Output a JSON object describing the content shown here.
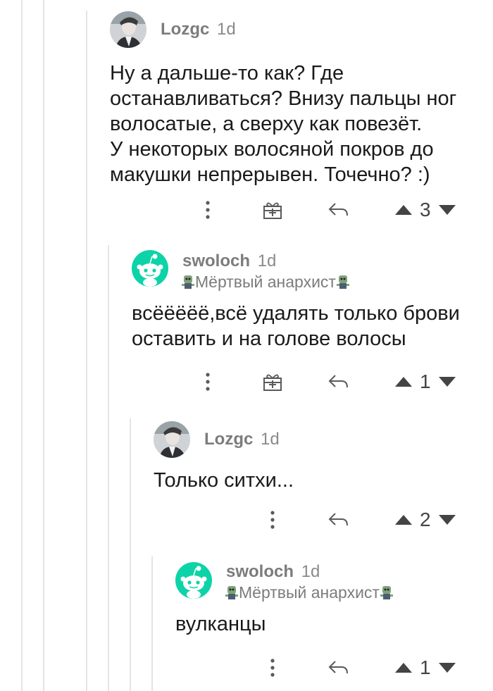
{
  "comments": [
    {
      "username": "Lozgc",
      "time": "1d",
      "flair": "",
      "body": "Ну а дальше-то как? Где\nостанавливаться? Внизу пальцы ног\nволосатые, а сверху как повезёт.\nУ некоторых волосяной покров до\nмакушки непрерывен. Точечно? :)",
      "score": "3"
    },
    {
      "username": "swoloch",
      "time": "1d",
      "flair": "Мёртвый анархист",
      "body": "всёёёёё,всё удалять только брови\nоставить и на голове волосы",
      "score": "1"
    },
    {
      "username": "Lozgc",
      "time": "1d",
      "flair": "",
      "body": "Только ситхи...",
      "score": "2"
    },
    {
      "username": "swoloch",
      "time": "1d",
      "flair": "Мёртвый анархист",
      "body": "вулканцы",
      "score": "1"
    }
  ],
  "icons": {
    "more": "more-options-icon",
    "award": "gift-award-icon",
    "reply": "reply-arrow-icon",
    "upvote": "upvote-arrow-icon",
    "downvote": "downvote-arrow-icon",
    "zombie": "zombie-emoji-icon"
  },
  "colors": {
    "snoo_bg": "#0dd3a8",
    "username": "#7c7c7c",
    "thread_line": "#e4e4e4",
    "icon": "#5a5a5a"
  }
}
